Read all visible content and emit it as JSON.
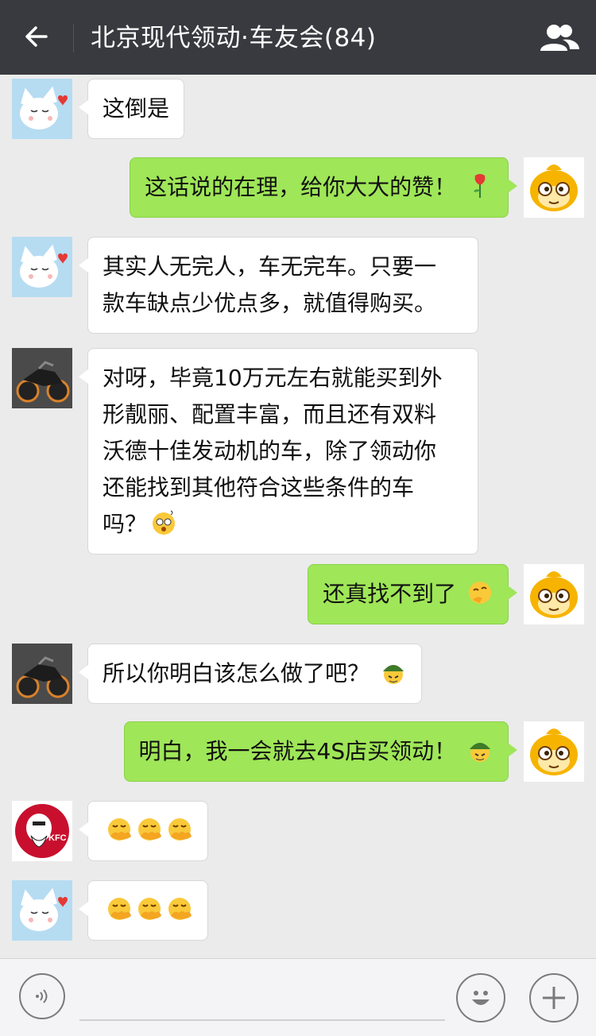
{
  "header": {
    "title": "北京现代领动·车友会(84)",
    "back_icon": "arrow-left-icon",
    "members_icon": "people-icon"
  },
  "messages": [
    {
      "side": "left",
      "avatar": "cat-avatar",
      "text": "这倒是"
    },
    {
      "side": "right",
      "avatar": "monkey-avatar",
      "text": "这话说的在理，给你大大的赞！",
      "emoji": "rose-icon"
    },
    {
      "side": "left",
      "avatar": "cat-avatar",
      "lines": [
        "其实人无完人，车无完车。只要一",
        "款车缺点少优点多，就值得购买。"
      ]
    },
    {
      "side": "left",
      "avatar": "motorcycle-avatar",
      "lines": [
        "对呀，毕竟10万元左右就能买到外",
        "形靓丽、配置丰富，而且还有双料",
        "沃德十佳发动机的车，除了领动你",
        "还能找到其他符合这些条件的车",
        "吗？"
      ],
      "emoji": "dizzy-face-icon"
    },
    {
      "side": "right",
      "avatar": "monkey-avatar",
      "text": "还真找不到了",
      "emoji": "thinking-face-icon"
    },
    {
      "side": "left",
      "avatar": "motorcycle-avatar",
      "text": "所以你明白该怎么做了吧？",
      "emoji": "army-helmet-face-icon"
    },
    {
      "side": "right",
      "avatar": "monkey-avatar",
      "text": "明白，我一会就去4S店买领动！",
      "emoji": "army-helmet-face-icon"
    },
    {
      "side": "left",
      "avatar": "kfc-avatar",
      "emoji_count": 3,
      "emoji": "covered-mouth-laugh-icon"
    },
    {
      "side": "left",
      "avatar": "cat-avatar",
      "emoji_count": 3,
      "emoji": "covered-mouth-laugh-icon"
    }
  ],
  "kfc_logo_text": "KFC",
  "bottom": {
    "voice_icon": "voice-icon",
    "emoji_icon": "smiley-icon",
    "plus_icon": "plus-icon"
  },
  "colors": {
    "header_bg": "#393a3f",
    "chat_bg": "#ebebeb",
    "bubble_sent": "#9fe658",
    "bubble_received": "#ffffff"
  }
}
